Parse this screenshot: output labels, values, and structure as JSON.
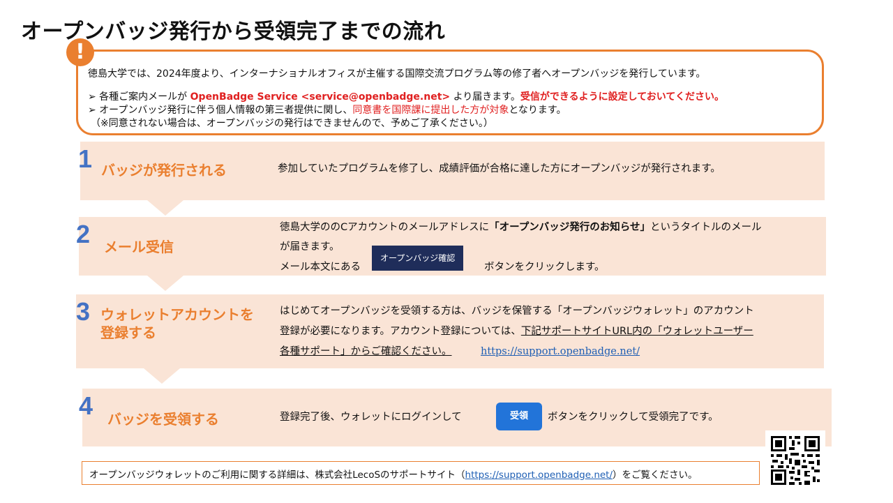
{
  "title": "オープンバッジ発行から受領完了までの流れ",
  "notice": {
    "icon": "exclamation-icon",
    "icon_glyph": "!",
    "line1": "徳島大学では、2024年度より、インターナショナルオフィスが主催する国際交流プログラム等の修了者へオープンバッジを発行しています。",
    "line2_pre": "➢ 各種ご案内メールが ",
    "line2_sender": "OpenBadge Service <service@openbadge.net>",
    "line2_mid": " より届きます。",
    "line2_emph": "受信ができるように設定しておいてください。",
    "line3_pre": "➢ オープンバッジ発行に伴う個人情報の第三者提供に関し、",
    "line3_red": "同意書を国際課に提出した方が対象",
    "line3_post": "となります。",
    "line4": "（※同意されない場合は、オープンバッジの発行はできませんので、予めご了承ください。）"
  },
  "steps": [
    {
      "number": "1",
      "title": "バッジが発行される",
      "desc": "参加していたプログラムを修了し、成績評価が合格に達した方にオープンバッジが発行されます。"
    },
    {
      "number": "2",
      "title": "メール受信",
      "desc_pre": "徳島大学ののCアカウントのメールアドレスに",
      "desc_bold": "「オープンバッジ発行のお知らせ」",
      "desc_post": "というタイトルのメール",
      "desc_line2": "が届きます。",
      "desc_line3_pre": "メール本文にある",
      "button": "オープンバッジ確認",
      "desc_line3_post": "ボタンをクリックします。"
    },
    {
      "number": "3",
      "title_line1": "ウォレットアカウントを",
      "title_line2": "登録する",
      "desc_line1": "はじめてオープンバッジを受領する方は、バッジを保管する「オープンバッジウォレット」のアカウント",
      "desc_line2_pre": "登録が必要になります。アカウント登録については、",
      "desc_line2_ul": "下記サポートサイトURL内の「ウォレットユーザー",
      "desc_line3_ul": "各種サポート」からご確認ください。",
      "link": "https://support.openbadge.net/"
    },
    {
      "number": "4",
      "title": "バッジを受領する",
      "desc_pre": "登録完了後、ウォレットにログインして",
      "button": "受領",
      "desc_post": "ボタンをクリックして受領完了です。"
    }
  ],
  "footer": {
    "pre": "オープンバッジウォレットのご利用に関する詳細は、株式会社LecoSのサポートサイト（",
    "link": "https://support.openbadge.net/",
    "post": "）をご覧ください。"
  },
  "colors": {
    "accent_orange": "#ea7f2f",
    "step_bg": "#fae4d6",
    "step_number": "#4472c4",
    "emphasis_red": "#e02020",
    "link_blue": "#1f5fb4",
    "navy_button": "#1f2d5a",
    "blue_button": "#2274d9"
  },
  "qr_code": "qr-code-image"
}
